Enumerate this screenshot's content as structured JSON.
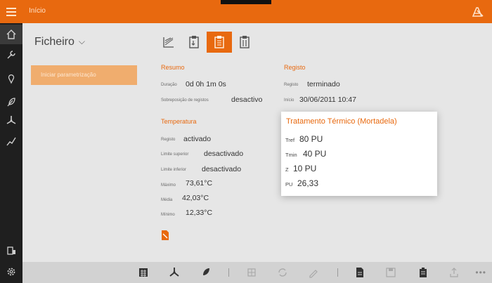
{
  "header": {
    "title": "Início"
  },
  "sidebar": {
    "items": [
      {
        "icon": "home-icon"
      },
      {
        "icon": "wrench-icon"
      },
      {
        "icon": "pin-icon"
      },
      {
        "icon": "feather-icon"
      },
      {
        "icon": "fan-icon"
      },
      {
        "icon": "chart-pen-icon"
      },
      {
        "icon": "device-icon"
      },
      {
        "icon": "settings-icon"
      }
    ]
  },
  "file_menu": {
    "label": "Ficheiro"
  },
  "param_button": {
    "label": "Iniciar parametrização"
  },
  "resumo": {
    "title": "Resumo",
    "duracao_label": "Duração",
    "duracao_value": "0d 0h 1m 0s",
    "sobreposicao_label": "Sobreposição de registos",
    "sobreposicao_value": "desactivo"
  },
  "registo": {
    "title": "Registo",
    "estado_label": "Registo",
    "estado_value": "terminado",
    "inicio_label": "Início",
    "inicio_value": "30/06/2011 10:47"
  },
  "temperatura": {
    "title": "Temperatura",
    "registo_label": "Registo",
    "registo_value": "activado",
    "limite_sup_label": "Limite superior",
    "limite_sup_value": "desactivado",
    "limite_inf_label": "Limite inferior",
    "limite_inf_value": "desactivado",
    "maximo_label": "Máximo",
    "maximo_value": "73,61°C",
    "media_label": "Média",
    "media_value": "42,03°C",
    "minimo_label": "Mínimo",
    "minimo_value": "12,33°C"
  },
  "popup": {
    "title": "Tratamento Térmico (Mortadela)",
    "tref_label": "Tref",
    "tref_value": "80 PU",
    "tmin_label": "Tmin",
    "tmin_value": "40 PU",
    "z_label": "Z",
    "z_value": "10 PU",
    "pu_label": "PU",
    "pu_value": "26,33"
  },
  "colors": {
    "accent": "#e8690f",
    "sidebar": "#1f1f1f",
    "background": "#e6e6e6",
    "bottombar": "#d2d2d2"
  }
}
